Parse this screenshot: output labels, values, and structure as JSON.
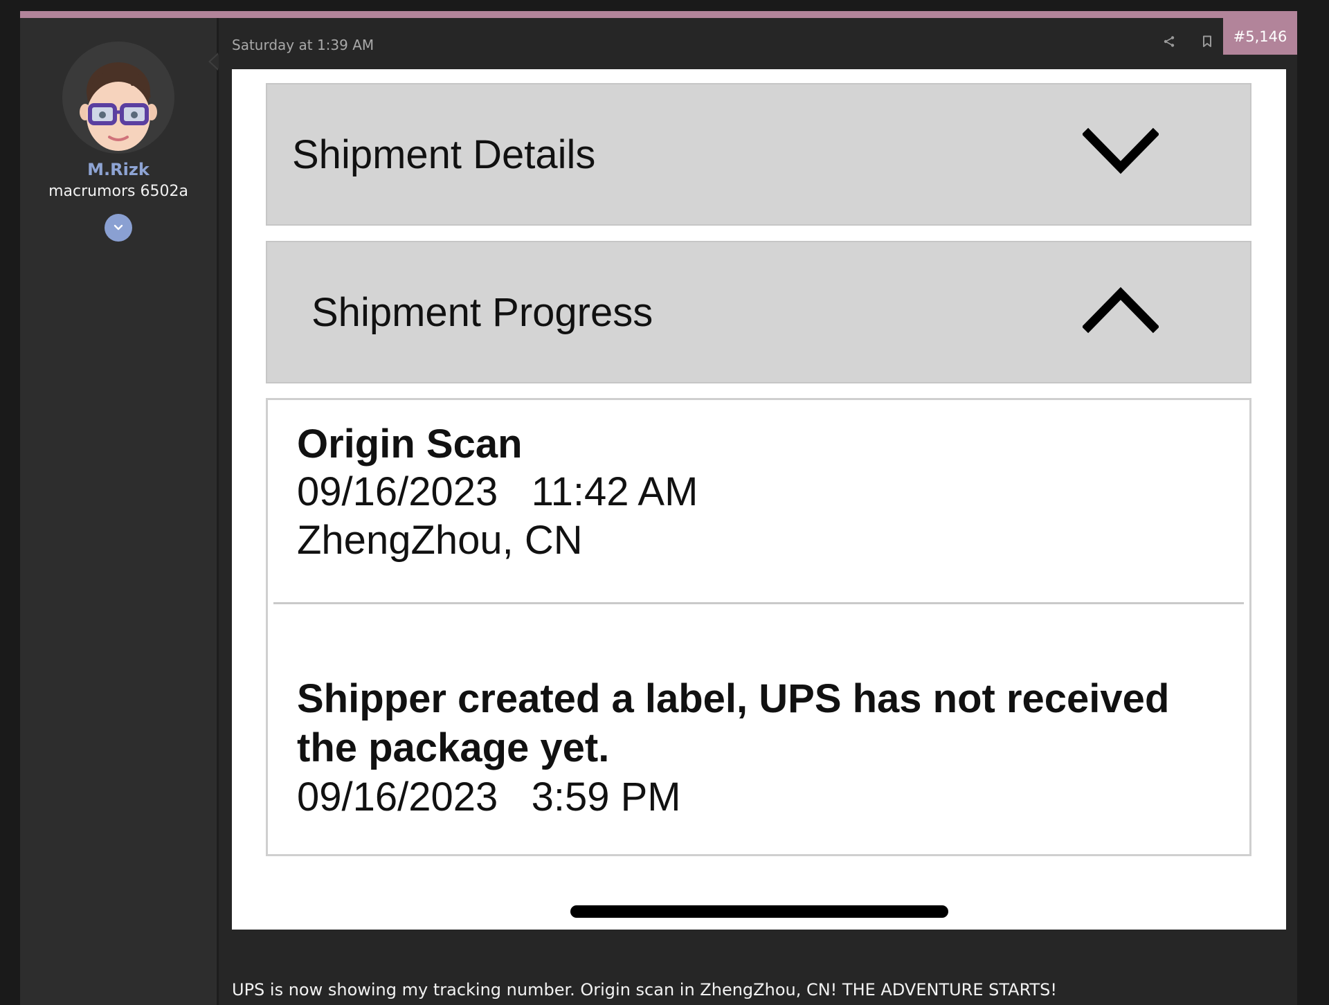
{
  "post": {
    "timestamp": "Saturday at 1:39 AM",
    "post_number": "#5,146",
    "text": "UPS is now showing my tracking number. Origin scan in ZhengZhou, CN! THE ADVENTURE STARTS!"
  },
  "user": {
    "name": "M.Rizk",
    "title": "macrumors 6502a"
  },
  "attachment": {
    "sections": [
      {
        "title": "Shipment Details",
        "state": "collapsed",
        "icon": "chevron-down-icon"
      },
      {
        "title": "Shipment Progress",
        "state": "expanded",
        "icon": "chevron-up-icon"
      }
    ],
    "events": [
      {
        "heading": "Origin Scan",
        "datetime": "09/16/2023   11:42 AM",
        "location": "ZhengZhou, CN"
      },
      {
        "heading_line1": "Shipper created a label, UPS has not received",
        "heading_line2": "the package yet.",
        "datetime": "09/16/2023   3:59 PM"
      }
    ]
  },
  "colors": {
    "accent": "#b2849a",
    "username": "#8ea4d4",
    "background": "#262626"
  }
}
